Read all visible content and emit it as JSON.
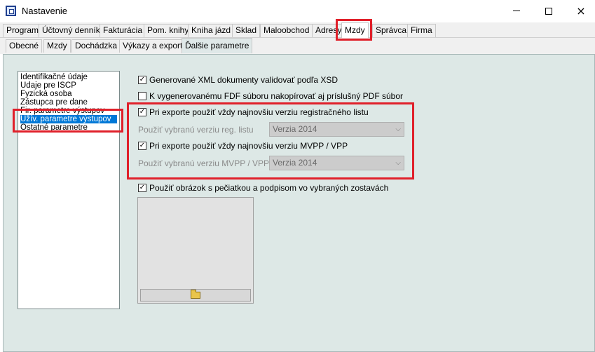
{
  "window": {
    "title": "Nastavenie"
  },
  "main_tabs": [
    {
      "label": "Program"
    },
    {
      "label": "Účtovný denník"
    },
    {
      "label": "Fakturácia"
    },
    {
      "label": "Pom. knihy"
    },
    {
      "label": "Kniha jázd"
    },
    {
      "label": "Sklad"
    },
    {
      "label": "Maloobchod"
    },
    {
      "label": "Adresy"
    },
    {
      "label": "Mzdy",
      "active": true
    },
    {
      "label": "Správca"
    },
    {
      "label": "Firma"
    }
  ],
  "sub_tabs": [
    {
      "label": "Obecné"
    },
    {
      "label": "Mzdy"
    },
    {
      "label": "Dochádzka"
    },
    {
      "label": "Výkazy a exporty"
    },
    {
      "label": "Ďalšie parametre",
      "active": true
    }
  ],
  "section_list": [
    {
      "label": "Identifikačné údaje"
    },
    {
      "label": "Údaje pre ISCP"
    },
    {
      "label": "Fyzická osoba"
    },
    {
      "label": "Zástupca pre dane"
    },
    {
      "label": "Fir. parametre výstupov"
    },
    {
      "label": "Užív. parametre výstupov",
      "selected": true
    },
    {
      "label": "Ostatné parametre"
    }
  ],
  "options": {
    "xml_validate": {
      "label": "Generované XML dokumenty validovať podľa XSD",
      "checked": true
    },
    "fdf_copy_pdf": {
      "label": "K vygenerovanému FDF súboru nakopírovať aj príslušný PDF súbor",
      "checked": false
    },
    "latest_reg_list": {
      "label": "Pri exporte použiť vždy najnovšiu verziu registračného listu",
      "checked": true
    },
    "reg_list_version": {
      "label": "Použiť vybranú verziu reg. listu",
      "value": "Verzia 2014"
    },
    "latest_mvpp": {
      "label": "Pri exporte použiť vždy najnovšiu verziu MVPP / VPP",
      "checked": true
    },
    "mvpp_version": {
      "label": "Použiť vybranú verziu MVPP / VPP",
      "value": "Verzia 2014"
    },
    "use_stamp_image": {
      "label": "Použiť obrázok s pečiatkou a podpisom vo vybraných zostavách",
      "checked": true
    }
  },
  "icons": {
    "check": "✓",
    "dropdown": "chevron-down",
    "folder": "open-folder",
    "close": "×"
  },
  "colors": {
    "annotation_red": "#e0202a",
    "selection_blue": "#0078d7",
    "panel_bg": "#dde8e6"
  }
}
